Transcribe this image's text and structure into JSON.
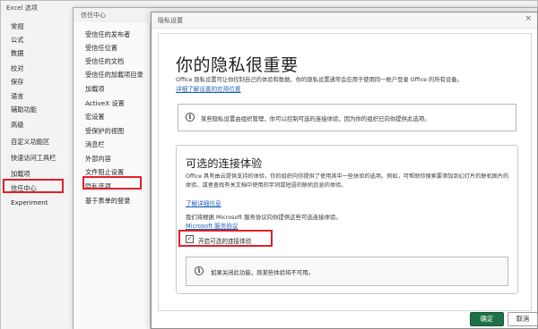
{
  "excel_window": {
    "title": "Excel 选项",
    "nav": [
      "常规",
      "公式",
      "数据",
      "校对",
      "保存",
      "语言",
      "辅助功能",
      "高级",
      "自定义功能区",
      "快速访问工具栏",
      "加载项",
      "信任中心",
      "Experiment"
    ]
  },
  "trust_center": {
    "title": "信任中心",
    "nav": [
      "受信任的发布者",
      "受信任位置",
      "受信任的文档",
      "受信任的加载项目录",
      "加载项",
      "ActiveX 设置",
      "宏设置",
      "受保护的视图",
      "消息栏",
      "外部内容",
      "文件阻止设置",
      "隐私选项",
      "基于表单的登录"
    ]
  },
  "privacy_dialog": {
    "title": "隐私设置",
    "heading": "你的隐私很重要",
    "description": "Office 隐私设置可让你控制自己的体验和数据。你的隐私设置通常会应用于使用同一帐户登录 Office 的所有设备。",
    "learn_more_link": "详细了解设置的应用位置",
    "org_notice": "某些隐私设置由组织管理，你可以控制可选的连接体验，因为你的组织已向你提供此选项。",
    "optional_section": {
      "heading": "可选的连接体验",
      "description": "Office 具有由云提供支持的体验，你的组织向你提供了使用其中一些体验的选项。例如，可帮助你搜索要添加到幻灯片的联机图片的体验，或者查找有关文档中使用的字词或短语的联机信息的体验。",
      "learn_more_link": "了解详细信息",
      "terms_text": "我们将根据 Microsoft 服务协议向你提供这些可选连接体验。",
      "terms_link": "Microsoft 服务协议",
      "checkbox_label": "开启可选的连接体验",
      "checkbox_checked": true,
      "off_notice": "如果关闭此功能，则某些体验将不可用。"
    }
  },
  "buttons": {
    "ok": "确定",
    "cancel": "取消"
  },
  "colors": {
    "highlight": "#e0202a",
    "ok_button": "#1e7145",
    "link": "#1d5fb8"
  }
}
